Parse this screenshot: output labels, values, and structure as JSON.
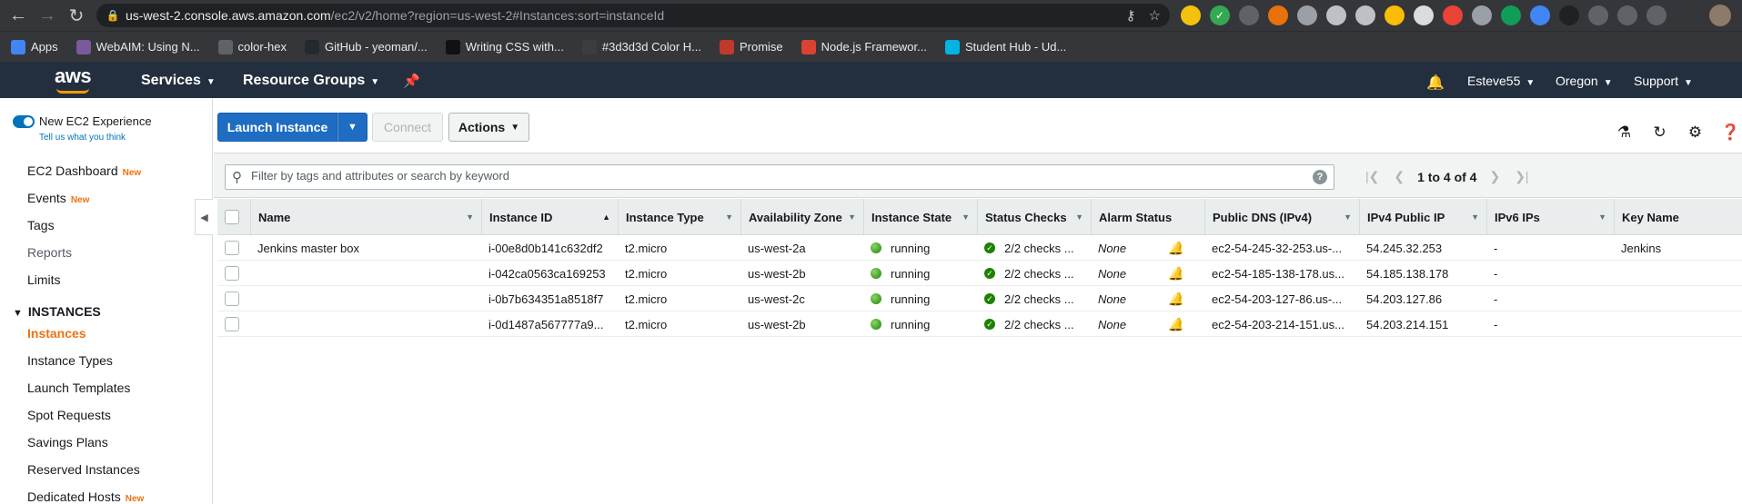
{
  "browser": {
    "url_host": "us-west-2.console.aws.amazon.com",
    "url_path": "/ec2/v2/home?region=us-west-2#Instances:sort=instanceId"
  },
  "bookmarks": [
    {
      "label": "Apps",
      "icon": "apps-grid-icon",
      "color": "#4285f4"
    },
    {
      "label": "WebAIM: Using N...",
      "icon": "webaim-icon",
      "color": "#7a5a9c"
    },
    {
      "label": "color-hex",
      "icon": "colorhex-icon",
      "color": "#5f6368"
    },
    {
      "label": "GitHub - yeoman/...",
      "icon": "github-icon",
      "color": "#24292e"
    },
    {
      "label": "Writing CSS with...",
      "icon": "medium-icon",
      "color": "#111111"
    },
    {
      "label": "#3d3d3d Color H...",
      "icon": "colorhex-icon",
      "color": "#3d3d3d"
    },
    {
      "label": "Promise",
      "icon": "promise-icon",
      "color": "#c0392b"
    },
    {
      "label": "Node.js Framewor...",
      "icon": "nodejs-icon",
      "color": "#d9432f"
    },
    {
      "label": "Student Hub - Ud...",
      "icon": "udacity-icon",
      "color": "#02b3e4"
    }
  ],
  "header": {
    "services": "Services",
    "resource_groups": "Resource Groups",
    "user": "Esteve55",
    "region": "Oregon",
    "support": "Support"
  },
  "sidebar": {
    "new_experience": "New EC2 Experience",
    "tell_us": "Tell us what you think",
    "badge_new": "New",
    "items_top": [
      {
        "label": "EC2 Dashboard",
        "new": true
      },
      {
        "label": "Events",
        "new": true
      },
      {
        "label": "Tags",
        "new": false
      },
      {
        "label": "Reports",
        "new": false
      },
      {
        "label": "Limits",
        "new": false
      }
    ],
    "section": "INSTANCES",
    "items_instances": [
      {
        "label": "Instances",
        "new": false
      },
      {
        "label": "Instance Types",
        "new": false
      },
      {
        "label": "Launch Templates",
        "new": false
      },
      {
        "label": "Spot Requests",
        "new": false
      },
      {
        "label": "Savings Plans",
        "new": false
      },
      {
        "label": "Reserved Instances",
        "new": false
      },
      {
        "label": "Dedicated Hosts",
        "new": true
      }
    ]
  },
  "toolbar": {
    "launch": "Launch Instance",
    "connect": "Connect",
    "actions": "Actions"
  },
  "search": {
    "placeholder": "Filter by tags and attributes or search by keyword"
  },
  "pager": {
    "text": "1 to 4 of 4"
  },
  "table": {
    "columns": [
      "Name",
      "Instance ID",
      "Instance Type",
      "Availability Zone",
      "Instance State",
      "Status Checks",
      "Alarm Status",
      "Public DNS (IPv4)",
      "IPv4 Public IP",
      "IPv6 IPs",
      "Key Name"
    ],
    "sorted_column": "Instance ID",
    "rows": [
      {
        "name": "Jenkins master box",
        "id": "i-00e8d0b141c632df2",
        "type": "t2.micro",
        "az": "us-west-2a",
        "state": "running",
        "checks": "2/2 checks ...",
        "alarm": "None",
        "dns": "ec2-54-245-32-253.us-...",
        "ip": "54.245.32.253",
        "ipv6": "-",
        "key": "Jenkins"
      },
      {
        "name": "",
        "id": "i-042ca0563ca169253",
        "type": "t2.micro",
        "az": "us-west-2b",
        "state": "running",
        "checks": "2/2 checks ...",
        "alarm": "None",
        "dns": "ec2-54-185-138-178.us...",
        "ip": "54.185.138.178",
        "ipv6": "-",
        "key": ""
      },
      {
        "name": "",
        "id": "i-0b7b634351a8518f7",
        "type": "t2.micro",
        "az": "us-west-2c",
        "state": "running",
        "checks": "2/2 checks ...",
        "alarm": "None",
        "dns": "ec2-54-203-127-86.us-...",
        "ip": "54.203.127.86",
        "ipv6": "-",
        "key": ""
      },
      {
        "name": "",
        "id": "i-0d1487a567777a9...",
        "type": "t2.micro",
        "az": "us-west-2b",
        "state": "running",
        "checks": "2/2 checks ...",
        "alarm": "None",
        "dns": "ec2-54-203-214-151.us...",
        "ip": "54.203.214.151",
        "ipv6": "-",
        "key": ""
      }
    ]
  },
  "colors": {
    "aws_header": "#232f3e",
    "aws_orange": "#ff9900",
    "primary_button": "#1e6dc2",
    "running_green": "#1d8102",
    "active_nav": "#ec7211"
  }
}
